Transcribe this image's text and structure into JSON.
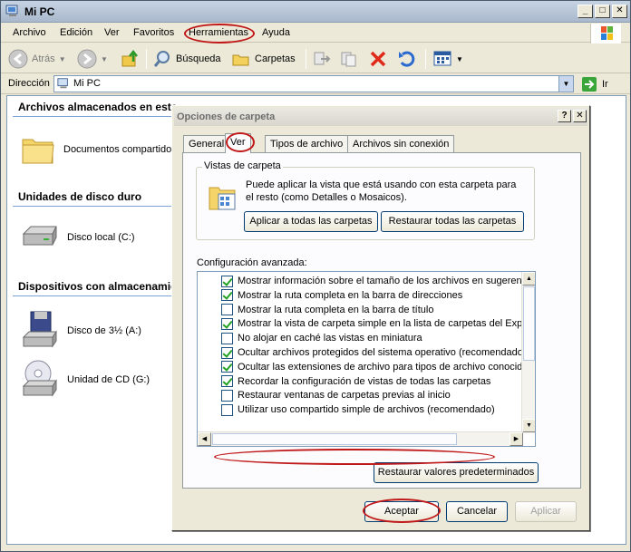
{
  "window": {
    "title": "Mi PC"
  },
  "menu": [
    "Archivo",
    "Edición",
    "Ver",
    "Favoritos",
    "Herramientas",
    "Ayuda"
  ],
  "toolbar": {
    "back": "Atrás",
    "search": "Búsqueda",
    "folders": "Carpetas"
  },
  "address": {
    "label": "Dirección",
    "value": "Mi PC",
    "go": "Ir"
  },
  "content": {
    "groups": [
      {
        "title": "Archivos almacenados en este",
        "items": [
          "Documentos compartidos"
        ]
      },
      {
        "title": "Unidades de disco duro",
        "items": [
          "Disco local (C:)"
        ]
      },
      {
        "title": "Dispositivos con almacenamie",
        "items": [
          "Disco de 3½ (A:)",
          "Unidad de CD (G:)"
        ]
      }
    ]
  },
  "dialog": {
    "title": "Opciones de carpeta",
    "help_btn": "?",
    "close_btn": "✕",
    "tabs": [
      "General",
      "Ver",
      "Tipos de archivo",
      "Archivos sin conexión"
    ],
    "active_tab": "Ver",
    "vistas": {
      "legend": "Vistas de carpeta",
      "desc": "Puede aplicar la vista que está usando con esta carpeta para el resto (como Detalles o Mosaicos).",
      "apply_btn": "Aplicar a todas las carpetas",
      "reset_btn": "Restaurar todas las carpetas"
    },
    "advanced_label": "Configuración avanzada:",
    "settings": [
      {
        "label": "Mostrar información sobre el tamaño de los archivos en sugerencia",
        "checked": true
      },
      {
        "label": "Mostrar la ruta completa en la barra de direcciones",
        "checked": true
      },
      {
        "label": "Mostrar la ruta completa en la barra de título",
        "checked": false
      },
      {
        "label": "Mostrar la vista de carpeta simple en la lista de carpetas del Explor",
        "checked": true
      },
      {
        "label": "No alojar en caché las vistas en miniatura",
        "checked": false
      },
      {
        "label": "Ocultar archivos protegidos del sistema operativo (recomendado)",
        "checked": true
      },
      {
        "label": "Ocultar las extensiones de archivo para tipos de archivo conocido",
        "checked": true
      },
      {
        "label": "Recordar la configuración de vistas de todas las carpetas",
        "checked": true
      },
      {
        "label": "Restaurar ventanas de carpetas previas al inicio",
        "checked": false
      },
      {
        "label": "Utilizar uso compartido simple de archivos (recomendado)",
        "checked": false
      }
    ],
    "restore_defaults": "Restaurar valores predeterminados",
    "ok": "Aceptar",
    "cancel": "Cancelar",
    "apply": "Aplicar"
  },
  "colors": {
    "highlight_ellipse": "#c01818",
    "check": "#21a121"
  }
}
